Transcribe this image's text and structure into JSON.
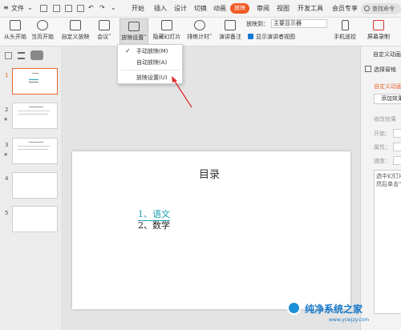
{
  "menubar": {
    "file": "文件",
    "tabs": [
      "开始",
      "插入",
      "设计",
      "切换",
      "动画",
      "放映",
      "审阅",
      "视图",
      "开发工具",
      "会员专享"
    ],
    "active_tab": "放映",
    "search": "查找命令"
  },
  "ribbon": {
    "from_start": "从头开始",
    "from_current": "当页开始",
    "custom": "自定义放映",
    "meeting": "会议",
    "settings": "放映设置",
    "hide_slide": "隐藏幻灯片",
    "rehearse": "排练计时",
    "speaker_notes": "演讲备注",
    "play_to_label": "放映到：",
    "monitor": "主要显示器",
    "show_presenter": "显示演讲者视图",
    "phone_remote": "手机遥控",
    "screen_record": "屏幕录制"
  },
  "dropdown": {
    "items": [
      "手动放映(M)",
      "自动放映(A)",
      "放映设置(U)"
    ]
  },
  "thumbnails": {
    "numbers": [
      "1",
      "2",
      "3",
      "4",
      "5"
    ]
  },
  "slide": {
    "title": "目录",
    "item1": "1、语文",
    "item2": "2、数学"
  },
  "right_panel": {
    "title": "自定义动画",
    "select_pane": "选择窗格",
    "section": "自定义动画",
    "add_effect": "添加效果",
    "modify": "修改效果",
    "start": "开始：",
    "property": "属性：",
    "speed": "速度：",
    "hint": "选中幻灯片的元素，然后单击\"添加效果\""
  },
  "watermark": {
    "brand": "纯净系统之家",
    "url": "www.ycwjzy.com"
  },
  "colors": {
    "accent": "#f05a24",
    "link": "#1aa0b3"
  }
}
